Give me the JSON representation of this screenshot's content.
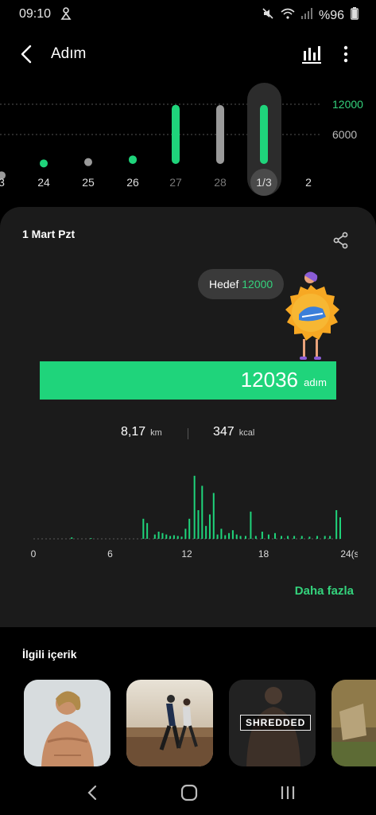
{
  "status_bar": {
    "time": "09:10",
    "battery": "%96"
  },
  "header": {
    "title": "Adım"
  },
  "weekly_chart": {
    "ticks": [
      "12000",
      "6000"
    ],
    "days": [
      "3",
      "24",
      "25",
      "26",
      "27",
      "28",
      "1/3",
      "2"
    ],
    "day_values": [
      2000,
      3800,
      4000,
      4400,
      12036,
      12000,
      12036,
      0
    ],
    "selected_day": "1/3",
    "colors": {
      "goal_met": "#1fd47b",
      "not_met": "#9a9a9a",
      "past": "#9a9a9a"
    }
  },
  "summary": {
    "date": "1 Mart Pzt",
    "goal_label": "Hedef",
    "goal_value": "12000",
    "steps": "12036",
    "steps_unit": "adım",
    "distance": "8,17",
    "distance_unit": "km",
    "calories": "347",
    "calories_unit": "kcal",
    "more_link": "Daha fazla"
  },
  "chart_data": {
    "type": "bar",
    "x_ticks": [
      "0",
      "6",
      "12",
      "18",
      "24(s)"
    ],
    "xlim": [
      0,
      24
    ],
    "values": [
      0,
      0,
      0,
      0,
      0,
      0,
      0,
      0,
      0,
      0,
      0,
      0,
      0,
      0,
      0,
      0,
      0,
      0,
      0,
      0,
      0,
      0,
      0,
      0,
      0,
      0,
      0,
      0,
      0,
      0,
      0,
      0,
      0,
      0,
      0,
      0,
      0,
      0,
      0,
      0,
      0,
      0,
      0,
      0,
      0,
      0,
      0,
      0,
      0,
      0,
      0,
      0,
      0,
      0,
      0,
      0,
      0,
      0,
      0,
      0,
      0,
      0,
      0,
      0,
      0,
      0,
      0,
      0,
      0,
      0,
      0,
      0,
      0,
      0,
      0,
      0,
      0,
      0,
      0,
      0,
      0,
      0,
      0,
      0,
      0,
      0,
      0,
      0,
      0,
      0,
      0,
      0,
      0,
      0,
      0,
      0,
      0,
      0,
      0,
      0,
      0,
      0,
      0,
      0,
      0,
      0,
      0,
      0,
      0,
      0,
      0,
      0,
      0,
      0,
      0,
      0,
      0,
      0,
      0,
      0,
      0,
      0,
      0,
      0,
      0,
      0,
      0,
      0,
      0,
      0,
      0,
      0,
      0,
      0,
      0,
      0,
      0,
      0,
      0,
      0,
      0,
      0,
      0,
      0
    ],
    "bars": [
      {
        "h": 8.6,
        "v": 28
      },
      {
        "h": 8.9,
        "v": 22
      },
      {
        "h": 9.5,
        "v": 6
      },
      {
        "h": 9.8,
        "v": 10
      },
      {
        "h": 10.1,
        "v": 8
      },
      {
        "h": 10.4,
        "v": 6
      },
      {
        "h": 10.7,
        "v": 4
      },
      {
        "h": 11.0,
        "v": 5
      },
      {
        "h": 11.3,
        "v": 4
      },
      {
        "h": 11.6,
        "v": 3
      },
      {
        "h": 11.9,
        "v": 14
      },
      {
        "h": 12.2,
        "v": 28
      },
      {
        "h": 12.6,
        "v": 88
      },
      {
        "h": 12.9,
        "v": 40
      },
      {
        "h": 13.2,
        "v": 74
      },
      {
        "h": 13.5,
        "v": 18
      },
      {
        "h": 13.8,
        "v": 34
      },
      {
        "h": 14.1,
        "v": 64
      },
      {
        "h": 14.4,
        "v": 6
      },
      {
        "h": 14.7,
        "v": 14
      },
      {
        "h": 15.0,
        "v": 5
      },
      {
        "h": 15.3,
        "v": 8
      },
      {
        "h": 15.6,
        "v": 12
      },
      {
        "h": 15.9,
        "v": 6
      },
      {
        "h": 16.2,
        "v": 4
      },
      {
        "h": 16.6,
        "v": 4
      },
      {
        "h": 17.0,
        "v": 38
      },
      {
        "h": 17.4,
        "v": 4
      },
      {
        "h": 17.9,
        "v": 10
      },
      {
        "h": 18.4,
        "v": 6
      },
      {
        "h": 18.9,
        "v": 8
      },
      {
        "h": 19.4,
        "v": 4
      },
      {
        "h": 19.9,
        "v": 4
      },
      {
        "h": 20.4,
        "v": 4
      },
      {
        "h": 21.0,
        "v": 4
      },
      {
        "h": 21.6,
        "v": 3
      },
      {
        "h": 22.2,
        "v": 4
      },
      {
        "h": 22.8,
        "v": 4
      },
      {
        "h": 23.2,
        "v": 4
      },
      {
        "h": 23.7,
        "v": 40
      },
      {
        "h": 24.0,
        "v": 30
      },
      {
        "h": 3.0,
        "v": 2
      },
      {
        "h": 4.5,
        "v": 1
      }
    ],
    "ylim": [
      0,
      100
    ],
    "color": "#1fd47b"
  },
  "related": {
    "title": "İlgili içerik",
    "items": [
      {
        "name": "muscle-man"
      },
      {
        "name": "runners"
      },
      {
        "name": "shredded",
        "label": "SHREDDED"
      },
      {
        "name": "outdoor-run"
      }
    ]
  }
}
